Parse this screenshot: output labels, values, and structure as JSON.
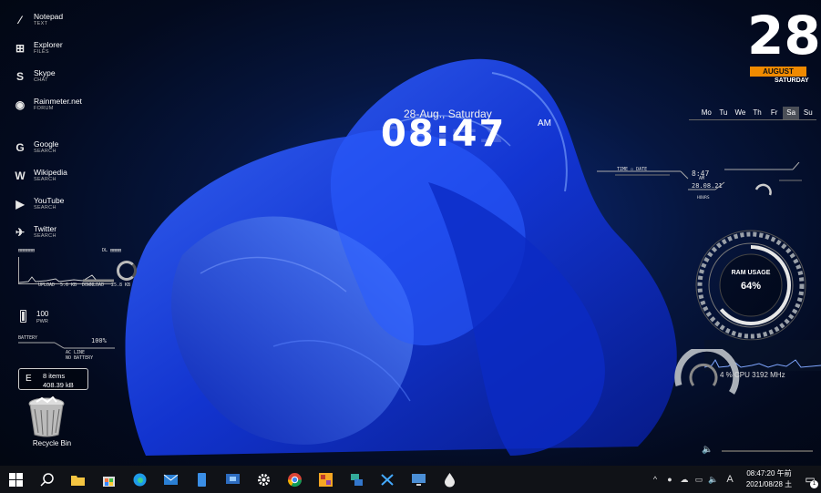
{
  "launcher": [
    {
      "name": "Notepad",
      "sub": "TEXT",
      "icon": "notepad-icon",
      "glyph": "⁄"
    },
    {
      "name": "Explorer",
      "sub": "FILES",
      "icon": "windows-icon",
      "glyph": "⊞"
    },
    {
      "name": "Skype",
      "sub": "CHAT",
      "icon": "skype-icon",
      "glyph": "S"
    },
    {
      "name": "Rainmeter.net",
      "sub": "FORUM",
      "icon": "rainmeter-drop-icon",
      "glyph": "◉"
    },
    {
      "name": "Google",
      "sub": "SEARCH",
      "icon": "google-icon",
      "glyph": "G"
    },
    {
      "name": "Wikipedia",
      "sub": "SEARCH",
      "icon": "wikipedia-icon",
      "glyph": "W"
    },
    {
      "name": "YouTube",
      "sub": "SEARCH",
      "icon": "youtube-icon",
      "glyph": "▶"
    },
    {
      "name": "Twitter",
      "sub": "SEARCH",
      "icon": "twitter-icon",
      "glyph": "✈"
    }
  ],
  "netmeter": {
    "upload_label": "UPLOAD",
    "upload_value": "5.6 KB",
    "download_label": "DOWNLOAD",
    "download_value": "25.8 KB"
  },
  "battery": {
    "value": "100",
    "label": "PWR",
    "title": "BATTERY",
    "percent": "100%",
    "line1": "AC LINE",
    "line2": "NO BATTERY",
    "level": 1.0
  },
  "recycle": {
    "letter": "E",
    "items": "8 items",
    "size": "408.39 kB",
    "label": "Recycle Bin"
  },
  "clock": {
    "date": "28-Aug., Saturday",
    "time": "08:47",
    "ampm": "AM"
  },
  "calendar": {
    "day": "28",
    "month": "AUGUST",
    "weekday": "SATURDAY",
    "week": [
      "Mo",
      "Tu",
      "We",
      "Th",
      "Fr",
      "Sa",
      "Su"
    ],
    "active_index": 5
  },
  "hud": {
    "time": "8:47",
    "ampm": "AM",
    "date": "28.08.21",
    "hours": "HOURS"
  },
  "ram": {
    "title": "RAM USAGE",
    "value": "64%",
    "level": 0.64
  },
  "cpu": {
    "text": "4 %   CPU 3192 MHz",
    "level": 0.04
  },
  "volume": {
    "level": 0.0
  },
  "taskbar": {
    "apps": [
      {
        "name": "start-button",
        "icon": "windows-icon"
      },
      {
        "name": "search-button",
        "icon": "search-icon"
      },
      {
        "name": "file-explorer-button",
        "icon": "folder-icon"
      },
      {
        "name": "store-button",
        "icon": "store-icon"
      },
      {
        "name": "edge-button",
        "icon": "edge-icon"
      },
      {
        "name": "mail-button",
        "icon": "mail-icon"
      },
      {
        "name": "phone-button",
        "icon": "phone-icon"
      },
      {
        "name": "remote-desktop-button",
        "icon": "remote-desktop-icon"
      },
      {
        "name": "settings-button",
        "icon": "gear-icon"
      },
      {
        "name": "chrome-button",
        "icon": "chrome-icon"
      },
      {
        "name": "paint-button",
        "icon": "paint-icon"
      },
      {
        "name": "network-tool-button",
        "icon": "network-icon"
      },
      {
        "name": "snipping-button",
        "icon": "scissors-icon"
      },
      {
        "name": "connect-button",
        "icon": "monitor-icon"
      },
      {
        "name": "rainmeter-button",
        "icon": "rainmeter-drop-icon"
      }
    ],
    "tray_clock_time": "08:47:20 午前",
    "tray_clock_date": "2021/08/28 土",
    "ime": "A",
    "notifications": "1"
  }
}
